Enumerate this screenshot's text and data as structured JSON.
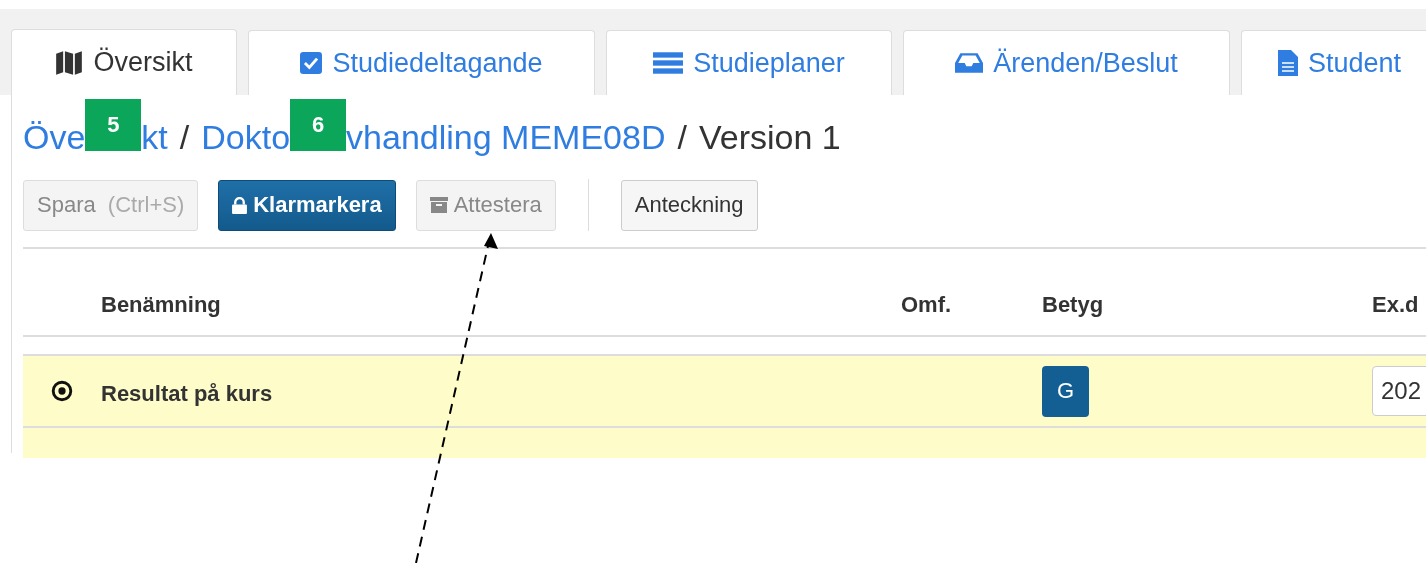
{
  "tabs": [
    {
      "label": "Översikt",
      "selected": true
    },
    {
      "label": "Studiedeltagande",
      "selected": false
    },
    {
      "label": "Studieplaner",
      "selected": false
    },
    {
      "label": "Ärenden/Beslut",
      "selected": false
    },
    {
      "label": "Student",
      "selected": false
    }
  ],
  "breadcrumb": [
    {
      "kind": "link",
      "text": "Öve"
    },
    {
      "kind": "marker",
      "text": "5"
    },
    {
      "kind": "link",
      "text": "kt"
    },
    {
      "kind": "separator",
      "text": "/"
    },
    {
      "kind": "link",
      "text": "Dokto"
    },
    {
      "kind": "marker",
      "text": "6"
    },
    {
      "kind": "link",
      "text": "vhandling MEME08D"
    },
    {
      "kind": "separator",
      "text": "/"
    },
    {
      "kind": "current",
      "text": "Version 1"
    }
  ],
  "toolbar": [
    {
      "label": "Spara",
      "hint": "(Ctrl+S)",
      "kind": "plain",
      "disabled": true
    },
    {
      "label": "Klarmarkera",
      "kind": "primary",
      "disabled": false
    },
    {
      "label": "Attestera",
      "kind": "plain",
      "disabled": true
    },
    {
      "kind": "divider"
    },
    {
      "label": "Anteckning",
      "kind": "plain",
      "disabled": false
    }
  ],
  "table": {
    "columns": [
      "Benämning",
      "Omf.",
      "Betyg",
      "Ex.d"
    ],
    "rows": [
      {
        "name": "Resultat på kurs",
        "selected": true,
        "grade": "G",
        "date": "202"
      }
    ]
  }
}
